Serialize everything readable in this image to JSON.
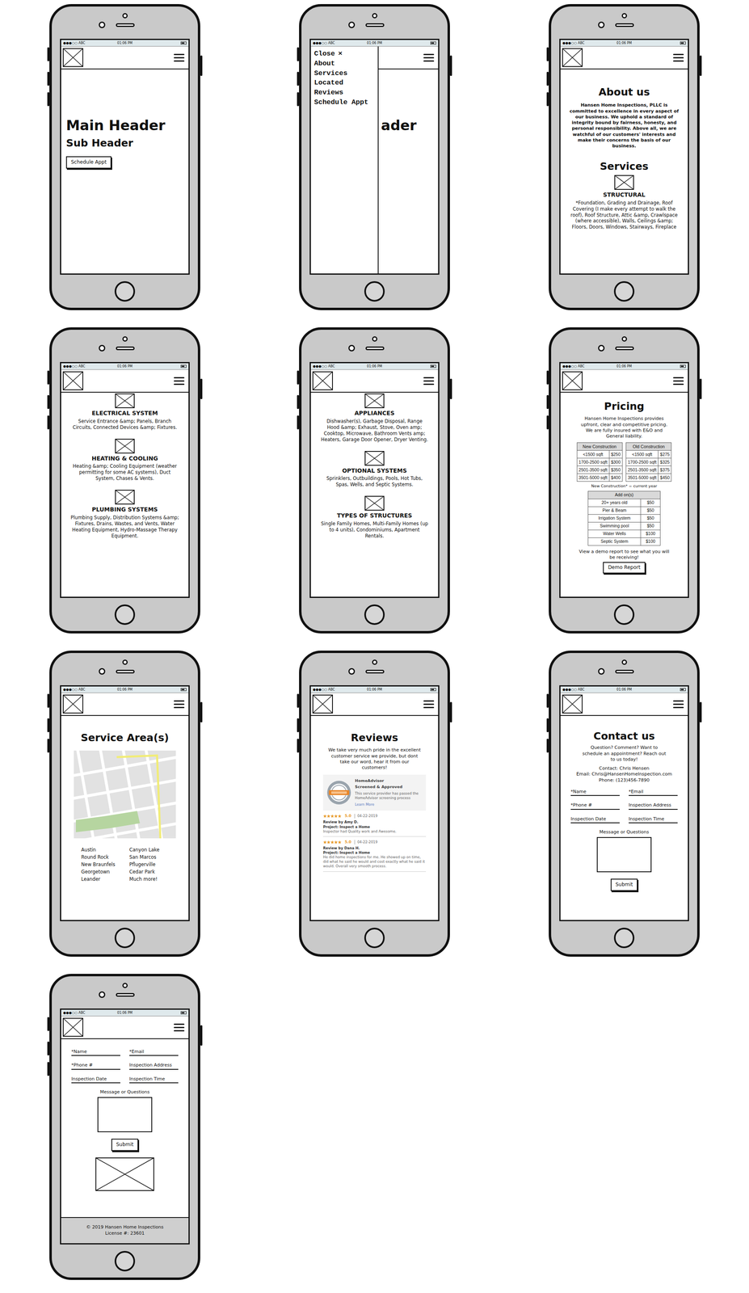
{
  "status_bar": {
    "carrier": "●●●○○ ABC",
    "time": "01:06 PM"
  },
  "phones": [
    {
      "kind": "home",
      "title": "Main Header",
      "subtitle": "Sub Header",
      "button": "Schedule Appt"
    },
    {
      "kind": "menu",
      "menu": {
        "close": "Close",
        "close_icon": "×",
        "items": [
          "About",
          "Services",
          "Located",
          "Reviews",
          "Schedule Appt"
        ]
      },
      "behind": "ader"
    },
    {
      "kind": "about",
      "title": "About us",
      "text": "Hansen Home Inspections, PLLC is committed to excellence in every aspect of our business. We uphold a standard of integrity bound by fairness, honesty, and personal responsibility. Above all, we are watchful of our customers' interests and make their concerns the basis of our business.",
      "section": "Services",
      "services": [
        {
          "title": "STRUCTURAL",
          "text": "*Foundation, Grading and Drainage, Roof Covering (I make every attempt to walk the roof), Roof Structure, Attic &amp, Crawlspace (where accessible), Walls, Ceilings &amp; Floors, Doors, Windows, Stairways, Fireplace"
        }
      ]
    },
    {
      "kind": "services",
      "services": [
        {
          "title": "ELECTRICAL SYSTEM",
          "text": "Service Entrance &amp; Panels, Branch Circuits, Connected Devices &amp; Fixtures."
        },
        {
          "title": "HEATING & COOLING",
          "text": "Heating &amp; Cooling Equipment (weather permitting for some AC systems), Duct System, Chases & Vents."
        },
        {
          "title": "PLUMBING SYSTEMS",
          "text": "Plumbing Supply, Distribution Systems &amp; Fixtures, Drains, Wastes, and Vents, Water Heating Equipment, Hydro-Massage Therapy Equipment."
        }
      ]
    },
    {
      "kind": "services",
      "services": [
        {
          "title": "APPLIANCES",
          "text": "Dishwasher(s), Garbage Disposal, Range Hood &amp; Exhaust, Stove, Oven amp; Cooktop, Microwave, Bathroom Vents amp; Heaters, Garage Door Opener, Dryer Venting."
        },
        {
          "title": "OPTIONAL SYSTEMS",
          "text": "Sprinklers, Outbuildings, Pools, Hot Tubs, Spas, Wells, and Septic Systems."
        },
        {
          "title": "TYPES OF STRUCTURES",
          "text": "Single Family Homes, Multi-Family Homes (up to 4 units), Condominiums, Apartment Rentals."
        }
      ]
    },
    {
      "kind": "pricing",
      "title": "Pricing",
      "text": "Hansen Home Inspections provides upfront, clear and competitive pricing. We are fully insured with E&O and General liability.",
      "tables": [
        {
          "title": "New Construction",
          "rows": [
            [
              "<1500 sqft",
              "$250"
            ],
            [
              "1700-2500 sqft",
              "$300"
            ],
            [
              "2501-3500 sqft",
              "$350"
            ],
            [
              "3501-5000 sqft",
              "$400"
            ]
          ]
        },
        {
          "title": "Old Construction",
          "rows": [
            [
              "<1500 sqft",
              "$275"
            ],
            [
              "1700-2500 sqft",
              "$325"
            ],
            [
              "2501-3500 sqft",
              "$375"
            ],
            [
              "3501-5000 sqft",
              "$450"
            ]
          ]
        }
      ],
      "note": "New Construction* = current year",
      "addons": {
        "title": "Add on(s)",
        "rows": [
          [
            "20+ years old",
            "$50"
          ],
          [
            "Pier & Beam",
            "$50"
          ],
          [
            "Irrigation System",
            "$50"
          ],
          [
            "Swimming pool",
            "$50"
          ],
          [
            "Water Wells",
            "$100"
          ],
          [
            "Septic System",
            "$100"
          ]
        ]
      },
      "demo_text": "View a demo report to see what you will be receiving!",
      "button": "Demo Report"
    },
    {
      "kind": "areas",
      "title": "Service Area(s)",
      "cities": [
        "Austin",
        "Canyon Lake",
        "Round Rock",
        "San Marcos",
        "New Braunfels",
        "Pflugerville",
        "Georgetown",
        "Cedar Park",
        "Leander",
        "Much more!"
      ]
    },
    {
      "kind": "reviews",
      "title": "Reviews",
      "text": "We take very much pride in the excellent customer service we provide, but dont take our word, hear it from our customers!",
      "badge": {
        "name": "HomeAdvisor",
        "status": "Screened & Approved",
        "text": "This service provider has passed the HomeAdvisor screening process",
        "link": "Learn More"
      },
      "reviews": [
        {
          "stars": 5,
          "rating": "5.0",
          "date": "04-22-2019",
          "author": "Review by Amy D.",
          "project": "Project: Inspect a Home",
          "text": "Inspector had Quality work and Awesome."
        },
        {
          "stars": 5,
          "rating": "5.0",
          "date": "04-22-2019",
          "author": "Review by Dana H.",
          "project": "Project: Inspect a Home",
          "text": "He did home inspections for me. He showed up on time, did what he said he would and cost exactly what he said it would. Overall very smooth process."
        }
      ]
    },
    {
      "kind": "contact",
      "title": "Contact us",
      "text": "Question? Comment? Want to schedule an appointment? Reach out to us today!",
      "contact": [
        "Contact: Chris Hensen",
        "Email: Chris@HansenHomeInspection.com",
        "Phone: (123)456-7890"
      ],
      "form": {
        "fields": [
          "*Name",
          "*Email",
          "*Phone #",
          "Inspection Address",
          "Inspection Date",
          "Inspection Time"
        ],
        "message": "Message or Questions",
        "submit": "Submit"
      }
    },
    {
      "kind": "form",
      "form": {
        "fields": [
          "*Name",
          "*Email",
          "*Phone #",
          "Inspection Address",
          "Inspection Date",
          "Inspection Time"
        ],
        "message": "Message or Questions",
        "submit": "Submit"
      },
      "footer": [
        "© 2019 Hansen Home Inspections",
        "License #: 23601"
      ]
    }
  ]
}
